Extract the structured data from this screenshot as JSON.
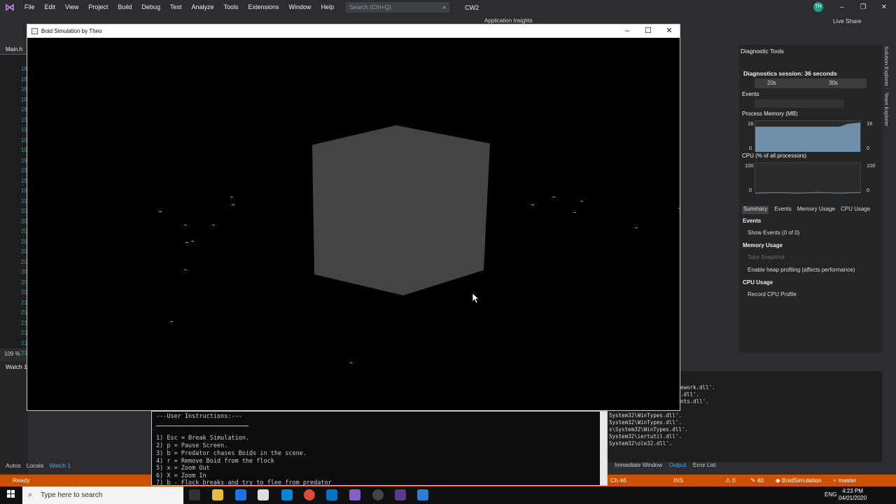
{
  "vs": {
    "menu": [
      "File",
      "Edit",
      "View",
      "Project",
      "Build",
      "Debug",
      "Test",
      "Analyze",
      "Tools",
      "Extensions",
      "Window",
      "Help"
    ],
    "search_placeholder": "Search (Ctrl+Q)",
    "solution_name": "CW2",
    "avatar_initials": "TH",
    "live_share": "Live Share",
    "app_insights": "Application Insights",
    "editor_tab": "Main.h",
    "line_numbers": [
      "18",
      "18",
      "18",
      "18",
      "19",
      "19",
      "19",
      "19",
      "19",
      "19",
      "19",
      "19",
      "19",
      "19",
      "20",
      "20",
      "20",
      "20",
      "20",
      "20",
      "20",
      "20",
      "20",
      "21",
      "21",
      "21",
      "21",
      "21",
      "21"
    ],
    "zoom": "109 %",
    "watch_title": "Watch 1",
    "bottom_tabs": [
      "Autos",
      "Locals",
      "Watch 1"
    ],
    "status": {
      "ready": "Ready",
      "ch": "Ch 46",
      "ins": "INS",
      "errors": "0",
      "warnings": "40",
      "project": "BoidSimulation",
      "branch": "master"
    }
  },
  "diagnostics": {
    "title": "Diagnostic Tools",
    "session": "Diagnostics session: 36 seconds",
    "ruler": [
      "20s",
      "30s"
    ],
    "events_label": "Events",
    "memory_label": "Process Memory (MB)",
    "memory_max": "16",
    "memory_min": "0",
    "cpu_label": "CPU (% of all processors)",
    "cpu_max": "100",
    "cpu_min": "0",
    "tabs": [
      "Summary",
      "Events",
      "Memory Usage",
      "CPU Usage"
    ],
    "events_head": "Events",
    "show_events": "Show Events (0 of 0)",
    "memory_head": "Memory Usage",
    "take_snapshot": "Take Snapshot",
    "heap_profiling": "Enable heap profiling (affects performance)",
    "cpu_head": "CPU Usage",
    "record_cpu": "Record CPU Profile",
    "side_tabs": [
      "Solution Explorer",
      "Team Explorer"
    ]
  },
  "output": {
    "lines": [
      "ework.dll'.",
      ".dll'.",
      "nts.dll'.",
      "System32\\WinTypes.dll'.",
      "System32\\WinTypes.dll'.",
      "s\\System32\\WinTypes.dll'.",
      "System32\\iertutil.dll'.",
      "System32\\ole32.dll'."
    ],
    "tabs": [
      "Immediate Window",
      "Output",
      "Error List"
    ]
  },
  "boid_window": {
    "title": "Boid Simulation by Theo",
    "cube_color": "#444444",
    "boid_color": "#39d353",
    "predator_color": "#e02020"
  },
  "console": {
    "header": "---User Instructions:---",
    "lines": [
      "1) Esc = Break Simulation.",
      "2) p = Pause Screen.",
      "3) b = Predator chases Boids in the scene.",
      "4) r = Remove Boid from the flock",
      "5) x = Zoom Out",
      "6) X = Zoom In",
      "7) b - Flock breaks and try to flee from predator"
    ]
  },
  "taskbar": {
    "search_placeholder": "Type here to search",
    "lang": "ENG",
    "time": "4:23 PM",
    "date": "04/01/2020"
  }
}
